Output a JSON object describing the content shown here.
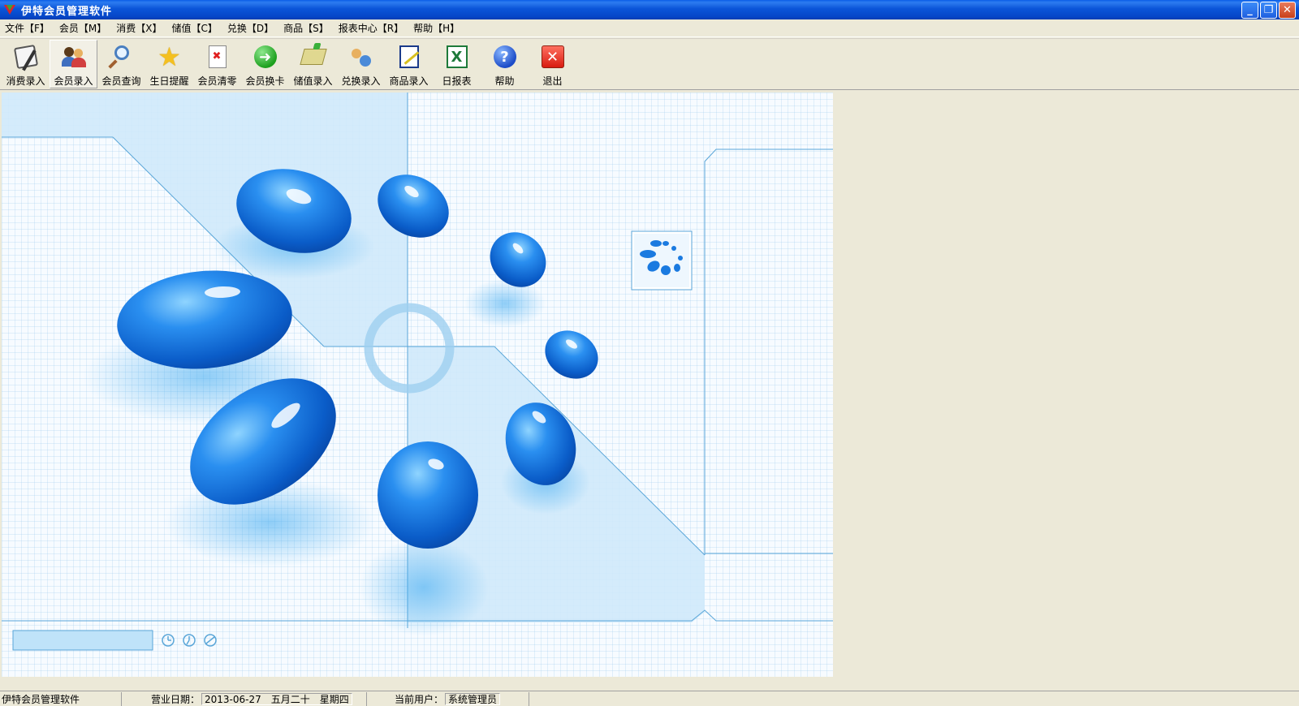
{
  "window": {
    "title": "伊特会员管理软件",
    "min_label": "_",
    "restore_label": "❐",
    "close_label": "✕"
  },
  "menu": [
    {
      "label": "文件【F】"
    },
    {
      "label": "会员【M】"
    },
    {
      "label": "消费【X】"
    },
    {
      "label": "储值【C】"
    },
    {
      "label": "兑换【D】"
    },
    {
      "label": "商品【S】"
    },
    {
      "label": "报表中心【R】"
    },
    {
      "label": "帮助【H】"
    }
  ],
  "toolbar": [
    {
      "label": "消费录入",
      "icon": "pen-receipt-icon"
    },
    {
      "label": "会员录入",
      "icon": "users-icon"
    },
    {
      "label": "会员查询",
      "icon": "magnifier-icon"
    },
    {
      "label": "生日提醒",
      "icon": "star-icon"
    },
    {
      "label": "会员清零",
      "icon": "clear-document-icon"
    },
    {
      "label": "会员换卡",
      "icon": "green-arrow-icon"
    },
    {
      "label": "储值录入",
      "icon": "money-icon"
    },
    {
      "label": "兑换录入",
      "icon": "exchange-icon"
    },
    {
      "label": "商品录入",
      "icon": "notebook-icon"
    },
    {
      "label": "日报表",
      "icon": "excel-icon"
    },
    {
      "label": "帮助",
      "icon": "help-icon"
    },
    {
      "label": "退出",
      "icon": "exit-icon"
    }
  ],
  "status": {
    "app_name": "伊特会员管理软件",
    "business_date_label": "营业日期：",
    "business_date_value": "2013-06-27　五月二十　星期四",
    "current_user_label": "当前用户：",
    "current_user_value": "系统管理员"
  },
  "colors": {
    "titlebar": "#0b55d8",
    "chrome": "#ece9d8",
    "drop_blue": "#1a7ae0",
    "panel_blue": "#cde9fb"
  }
}
